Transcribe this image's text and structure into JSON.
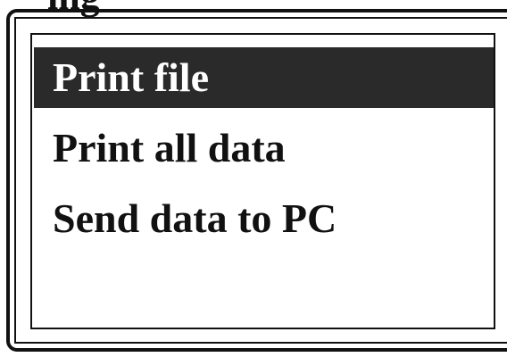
{
  "header": {
    "clipped_text": "ing"
  },
  "menu": {
    "items": [
      {
        "label": "Print file",
        "selected": true
      },
      {
        "label": "Print all data",
        "selected": false
      },
      {
        "label": "Send data to PC",
        "selected": false
      }
    ]
  },
  "colors": {
    "foreground": "#111111",
    "highlight": "#2a2a2a",
    "highlight_text": "#ffffff",
    "background": "#ffffff"
  }
}
